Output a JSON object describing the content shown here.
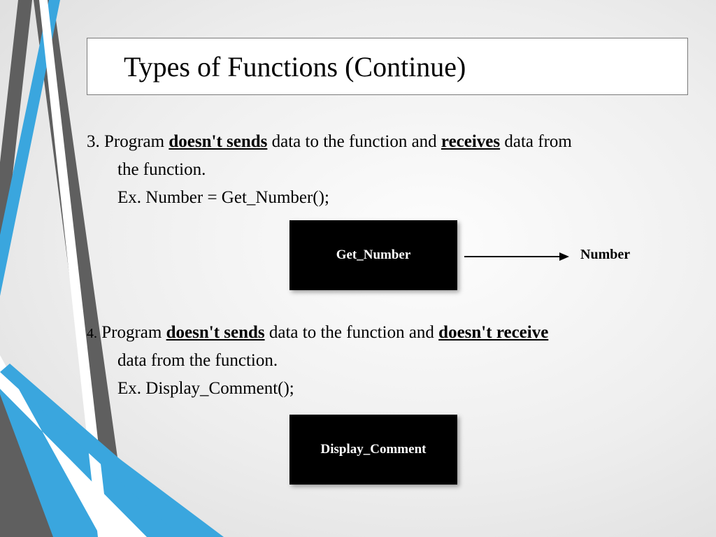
{
  "title": "Types of Functions (Continue)",
  "item3": {
    "num": "3.",
    "pre": " Program ",
    "u1": "doesn't sends",
    "mid": " data to the function and ",
    "u2": "receives",
    "post": " data from",
    "line2": "the function.",
    "ex": "Ex. Number = Get_Number();"
  },
  "diagram1": {
    "box": "Get_Number",
    "out": "Number"
  },
  "item4": {
    "num": "4.",
    "pre": " Program ",
    "u1": "doesn't sends",
    "mid": " data to the function and ",
    "u2": "doesn't receive",
    "line2": "data from the function.",
    "ex": "Ex. Display_Comment();"
  },
  "diagram2": {
    "box": "Display_Comment"
  }
}
